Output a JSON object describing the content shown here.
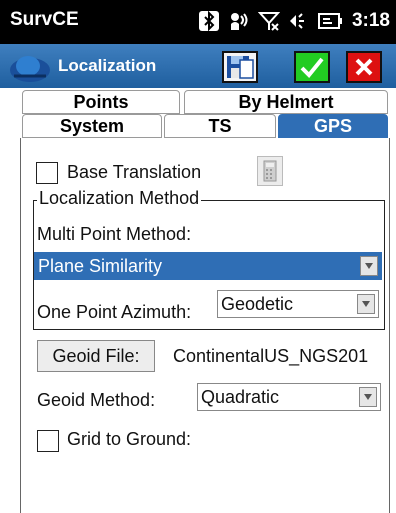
{
  "status": {
    "app_name": "SurvCE",
    "time": "3:18"
  },
  "header": {
    "title": "Localization"
  },
  "tabs": {
    "row1": [
      "Points",
      "By Helmert"
    ],
    "row2": [
      "System",
      "TS",
      "GPS"
    ]
  },
  "form": {
    "base_translation_label": "Base Translation",
    "localization_method_legend": "Localization Method",
    "multi_point_method_label": "Multi Point Method:",
    "multi_point_method_value": "Plane Similarity",
    "one_point_azimuth_label": "One Point Azimuth:",
    "one_point_azimuth_value": "Geodetic",
    "geoid_file_button": "Geoid File:",
    "geoid_file_value": "ContinentalUS_NGS201",
    "geoid_method_label": "Geoid Method:",
    "geoid_method_value": "Quadratic",
    "grid_to_ground_label": "Grid to Ground:"
  },
  "colors": {
    "accent": "#2f6eb5",
    "ok_green": "#22cc22",
    "close_red": "#dd1111"
  },
  "icons": [
    "bluetooth-icon",
    "signal-icon",
    "no-signal-icon",
    "volume-icon",
    "battery-icon",
    "surveyor-logo-icon",
    "save-icon",
    "check-icon",
    "close-icon",
    "calculator-icon",
    "dropdown-arrow-icon"
  ]
}
